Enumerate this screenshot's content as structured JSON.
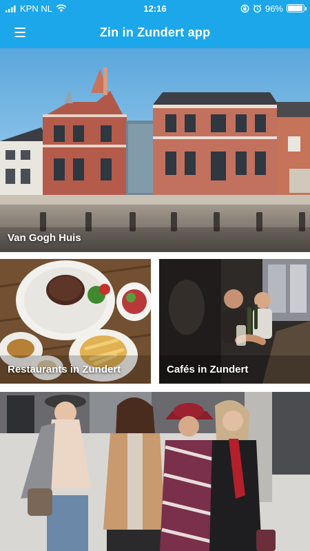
{
  "status_bar": {
    "carrier": "KPN NL",
    "time": "12:16",
    "battery_percent": "96%",
    "battery_level": 0.96
  },
  "app_bar": {
    "title": "Zin in Zundert app",
    "menu_icon": "hamburger-menu-icon"
  },
  "tiles": [
    {
      "label": "Van Gogh Huis"
    },
    {
      "label": "Restaurants in Zundert"
    },
    {
      "label": "Cafés in Zundert"
    },
    {
      "label": ""
    }
  ],
  "colors": {
    "brand": "#1ba7ea",
    "text_on_brand": "#ffffff"
  }
}
